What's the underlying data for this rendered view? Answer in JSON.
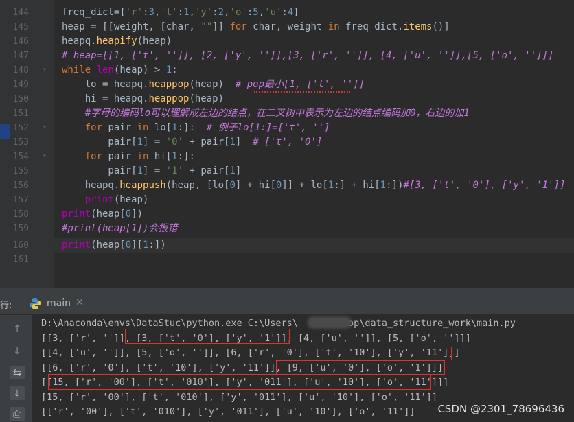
{
  "editor": {
    "lines": [
      {
        "num": "144",
        "text": "freq_dict={'r':3,'t':1,'y':2,'o':5,'u':4}"
      },
      {
        "num": "145",
        "text": "heap = [[weight, [char, \"\"]] for char, weight in freq_dict.items()]"
      },
      {
        "num": "146",
        "text": "heapq.heapify(heap)"
      },
      {
        "num": "147",
        "text": "# heap=[[1, ['t', '']], [2, ['y', '']],[3, ['r', '']], [4, ['u', '']],[5, ['o', '']]]"
      },
      {
        "num": "148",
        "text": "while len(heap) > 1:"
      },
      {
        "num": "149",
        "text": "    lo = heapq.heappop(heap)  # pop最小[1, ['t', '']]"
      },
      {
        "num": "150",
        "text": "    hi = heapq.heappop(heap)"
      },
      {
        "num": "151",
        "text": "    #字母的编码lo可以理解成左边的结点，在二叉树中表示为左边的结点编码加0，右边的加1"
      },
      {
        "num": "152",
        "text": "    for pair in lo[1:]:  # 例子lo[1:]=['t', '']"
      },
      {
        "num": "153",
        "text": "        pair[1] = '0' + pair[1]  # ['t', '0']"
      },
      {
        "num": "154",
        "text": "    for pair in hi[1:]:"
      },
      {
        "num": "155",
        "text": "        pair[1] = '1' + pair[1]"
      },
      {
        "num": "156",
        "text": "    heapq.heappush(heap, [lo[0] + hi[0]] + lo[1:] + hi[1:])#[3, ['t', '0'], ['y', '1']]"
      },
      {
        "num": "157",
        "text": "    print(heap)"
      },
      {
        "num": "158",
        "text": "print(heap[0])"
      },
      {
        "num": "159",
        "text": "#print(heap[1])会报错"
      },
      {
        "num": "160",
        "text": "print(heap[0][1:])"
      },
      {
        "num": "161",
        "text": ""
      }
    ]
  },
  "run_panel": {
    "run_label": "行:",
    "tab_name": "main",
    "close_glyph": "✕",
    "tool_icons": [
      "up-arrow-icon",
      "down-arrow-icon",
      "soft-wrap-icon",
      "scroll-to-end-icon",
      "print-icon"
    ]
  },
  "console": {
    "output_lines": [
      "D:\\Anaconda\\envs\\DataStuc\\python.exe C:\\Users\\      sktop\\data_structure_work\\main.py",
      "[[3, ['r', '']], [3, ['t', '0'], ['y', '1']], [4, ['u', '']], [5, ['o', '']]]",
      "[[4, ['u', '']], [5, ['o', '']], [6, ['r', '0'], ['t', '10'], ['y', '11']]]",
      "[[6, ['r', '0'], ['t', '10'], ['y', '11']], [9, ['u', '0'], ['o', '1']]]",
      "[[15, ['r', '00'], ['t', '010'], ['y', '011'], ['u', '10'], ['o', '11']]]",
      "[15, ['r', '00'], ['t', '010'], ['y', '011'], ['u', '10'], ['o', '11']]",
      "[['r', '00'], ['t', '010'], ['y', '011'], ['u', '10'], ['o', '11']]"
    ]
  },
  "watermark": "CSDN @2301_78696436",
  "colors": {
    "keyword": "#cc7832",
    "string": "#6a8759",
    "number": "#6897bb",
    "comment": "#c679dd",
    "highlight_box": "#e03030"
  }
}
